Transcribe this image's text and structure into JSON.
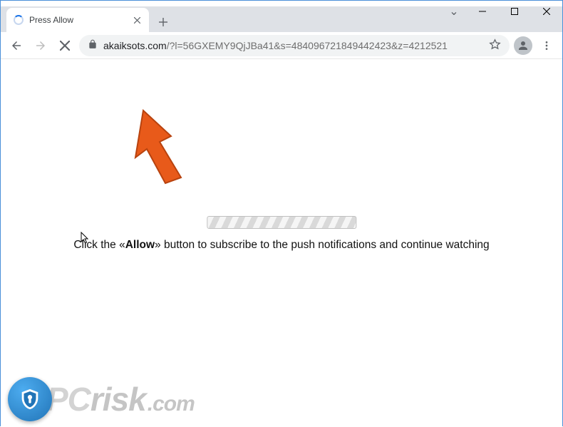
{
  "window": {
    "tab_title": "Press Allow",
    "dropdown_glyph": "⌄",
    "minimize": "",
    "maximize": "",
    "close": ""
  },
  "toolbar": {
    "url_domain": "akaiksots.com",
    "url_rest": "/?l=56GXEMY9QjJBa41&s=484096721849442423&z=4212521"
  },
  "page": {
    "message_pre": "Click the «",
    "message_bold": "Allow",
    "message_post": "» button to subscribe to the push notifications and continue watching"
  },
  "watermark": {
    "pc": "PC",
    "risk": "risk",
    "dotcom": ".com"
  }
}
